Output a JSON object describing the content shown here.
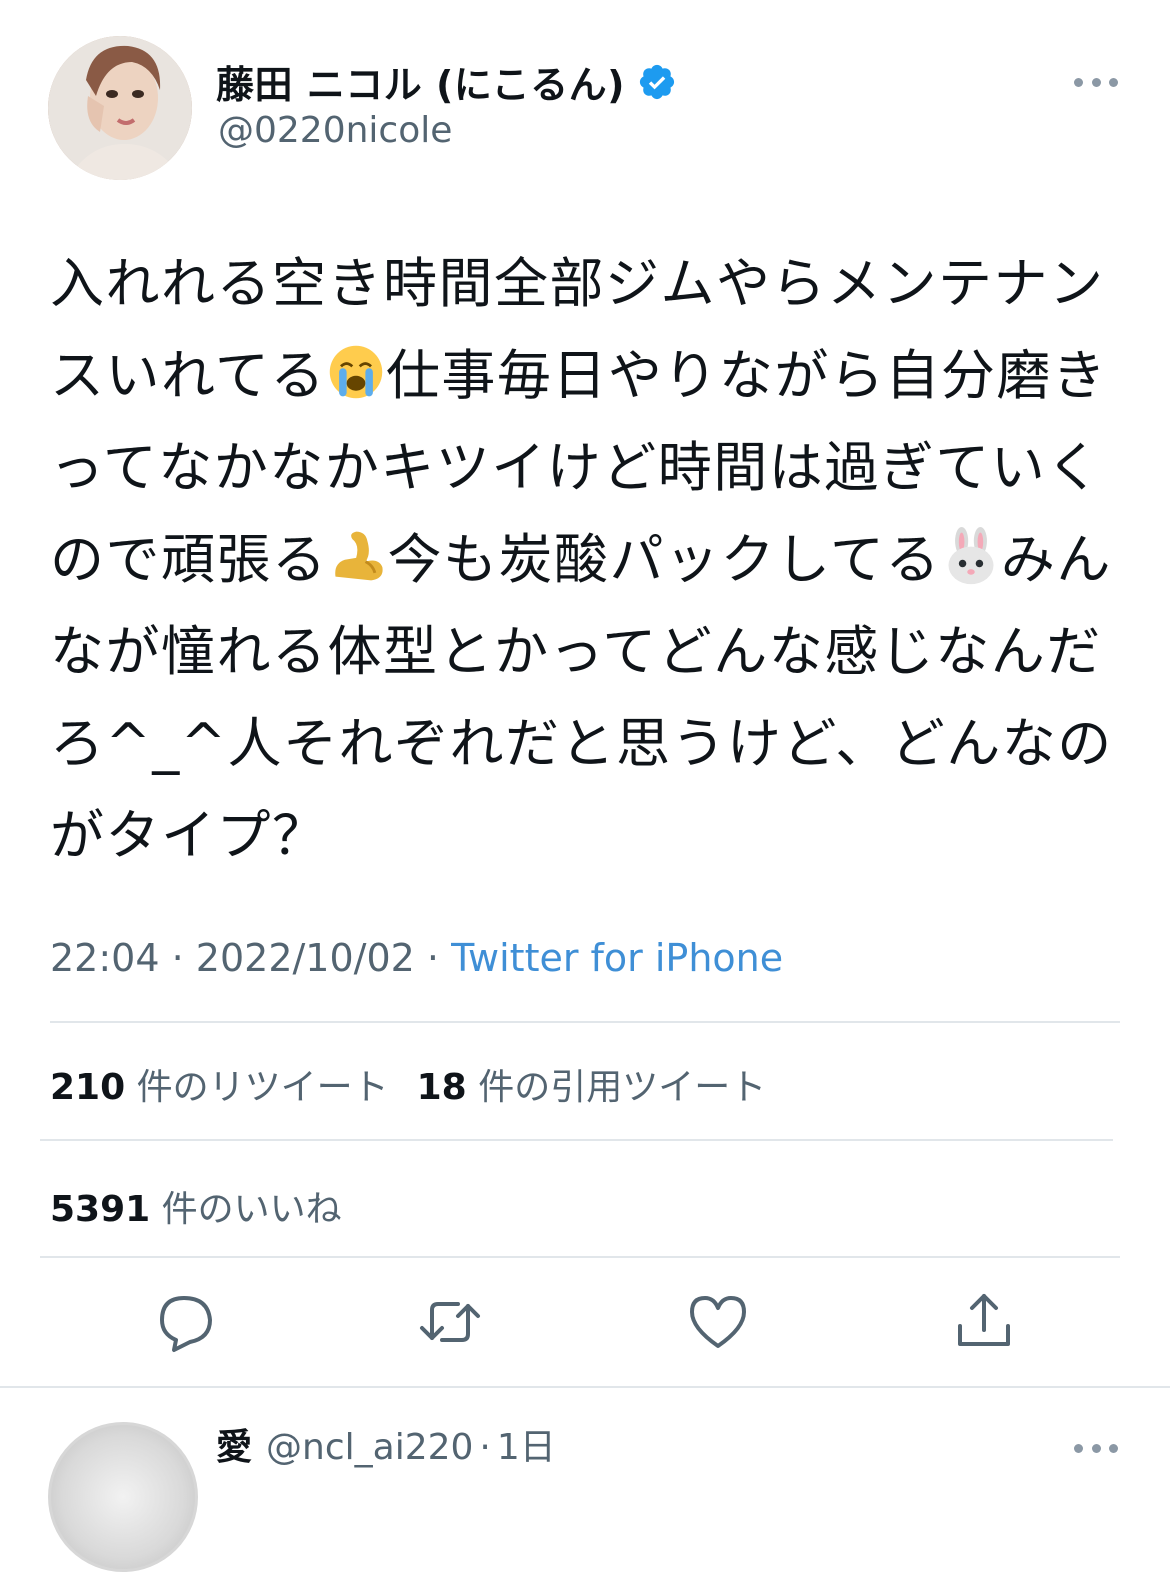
{
  "tweet": {
    "display_name": "藤田 ニコル (にこるん)",
    "handle": "@0220nicole",
    "text_parts": [
      "入れれる空き時間全部ジムやらメンテナンスいれてる",
      "仕事毎日やりながら自分磨きってなかなかキツイけど時間は過ぎていくので頑張る",
      "今も炭酸パックしてる",
      "みんなが憧れる体型とかってどんな感じなんだろ^_^人それぞれだと思うけど、どんなのがタイプ？"
    ],
    "emojis": [
      "crying-face",
      "flexed-biceps",
      "rabbit-face"
    ],
    "time": "22:04",
    "date": "2022/10/02",
    "source": "Twitter for iPhone",
    "separator": "·"
  },
  "stats": {
    "retweets_count": "210",
    "retweets_label": "件のリツイート",
    "quotes_count": "18",
    "quotes_label": "件の引用ツイート",
    "likes_count": "5391",
    "likes_label": "件のいいね"
  },
  "actions": [
    "reply-icon",
    "retweet-icon",
    "like-icon",
    "share-icon"
  ],
  "reply_preview": {
    "name": "愛",
    "handle": "@ncl_ai220",
    "time": "1日",
    "separator": "·"
  },
  "colors": {
    "text": "#0f1419",
    "secondary": "#536471",
    "link": "#3f8fd6",
    "verified": "#1d9bf0",
    "divider": "#e1e6ea"
  }
}
